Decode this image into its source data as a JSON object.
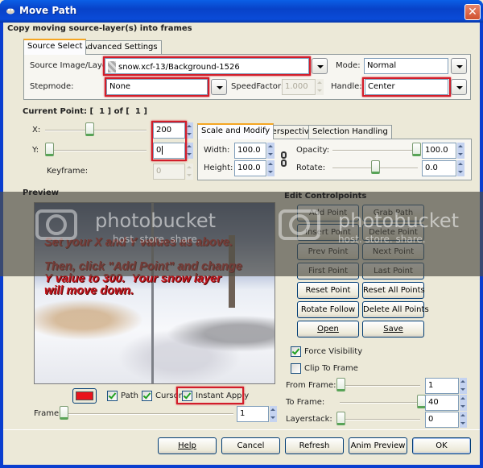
{
  "window": {
    "title": "Move Path",
    "close_icon": "close-icon"
  },
  "header": {
    "heading": "Copy moving source-layer(s) into frames"
  },
  "top_tabs": [
    {
      "label": "Source Select",
      "active": true
    },
    {
      "label": "Advanced Settings",
      "active": false
    }
  ],
  "source_select": {
    "source_label": "Source Image/Layer:",
    "source_value": "snow.xcf-13/Background-1526",
    "mode_label": "Mode:",
    "mode_value": "Normal",
    "stepmode_label": "Stepmode:",
    "stepmode_value": "None",
    "speedfactor_label": "SpeedFactor:",
    "speedfactor_value": "1.000",
    "handle_label": "Handle:",
    "handle_value": "Center"
  },
  "current_point": {
    "label_prefix": "Current Point: [",
    "current": "1",
    "label_mid": "] of [",
    "total": "1",
    "label_suffix": "]",
    "x_label": "X:",
    "x_value": "200",
    "x_slider_fraction": 0.4,
    "y_label": "Y:",
    "y_value": "0",
    "y_slider_fraction": 0.0,
    "keyframe_label": "Keyframe:",
    "keyframe_value": "0"
  },
  "modify_tabs": [
    {
      "label": "Scale and Modify",
      "active": true
    },
    {
      "label": "Perspective",
      "active": false
    },
    {
      "label": "Selection Handling",
      "active": false
    }
  ],
  "scale_modify": {
    "width_label": "Width:",
    "width_value": "100.0",
    "height_label": "Height:",
    "height_value": "100.0",
    "opacity_label": "Opacity:",
    "opacity_value": "100.0",
    "opacity_fraction": 1.0,
    "rotate_label": "Rotate:",
    "rotate_value": "0.0",
    "rotate_fraction": 0.5
  },
  "preview": {
    "label": "Preview",
    "note_lines": "Set your X and Y values as above.\n\nThen, click \"Add Point\" and change\nY value to 300.  Your snow layer\nwill move down.",
    "path_color": "#e8141c",
    "path_label": "Path",
    "path_checked": true,
    "cursor_label": "Cursor",
    "cursor_checked": true,
    "instant_apply_label": "Instant Apply",
    "instant_apply_checked": true,
    "frame_label": "Frame:",
    "frame_value": "1"
  },
  "watermark": {
    "brand": "photobucket",
    "tagline": "host. store. share."
  },
  "edit_controlpoints": {
    "label": "Edit Controlpoints",
    "buttons": [
      "Add Point",
      "Grab Path",
      "Insert Point",
      "Delete Point",
      "Prev Point",
      "Next Point",
      "First Point",
      "Last Point",
      "Reset Point",
      "Reset All Points",
      "Rotate Follow",
      "Delete All Points",
      "Open",
      "Save"
    ],
    "force_visibility_label": "Force Visibility",
    "force_visibility_checked": true,
    "clip_to_frame_label": "Clip To Frame",
    "clip_to_frame_checked": false,
    "from_frame_label": "From Frame:",
    "from_frame_value": "1",
    "from_frame_fraction": 0.0,
    "to_frame_label": "To Frame:",
    "to_frame_value": "40",
    "to_frame_fraction": 1.0,
    "layerstack_label": "Layerstack:",
    "layerstack_value": "0",
    "layerstack_fraction": 0.0
  },
  "footer_buttons": [
    "Help",
    "Cancel",
    "Refresh",
    "Anim Preview",
    "OK"
  ],
  "highlight_color": "#d21d2a"
}
